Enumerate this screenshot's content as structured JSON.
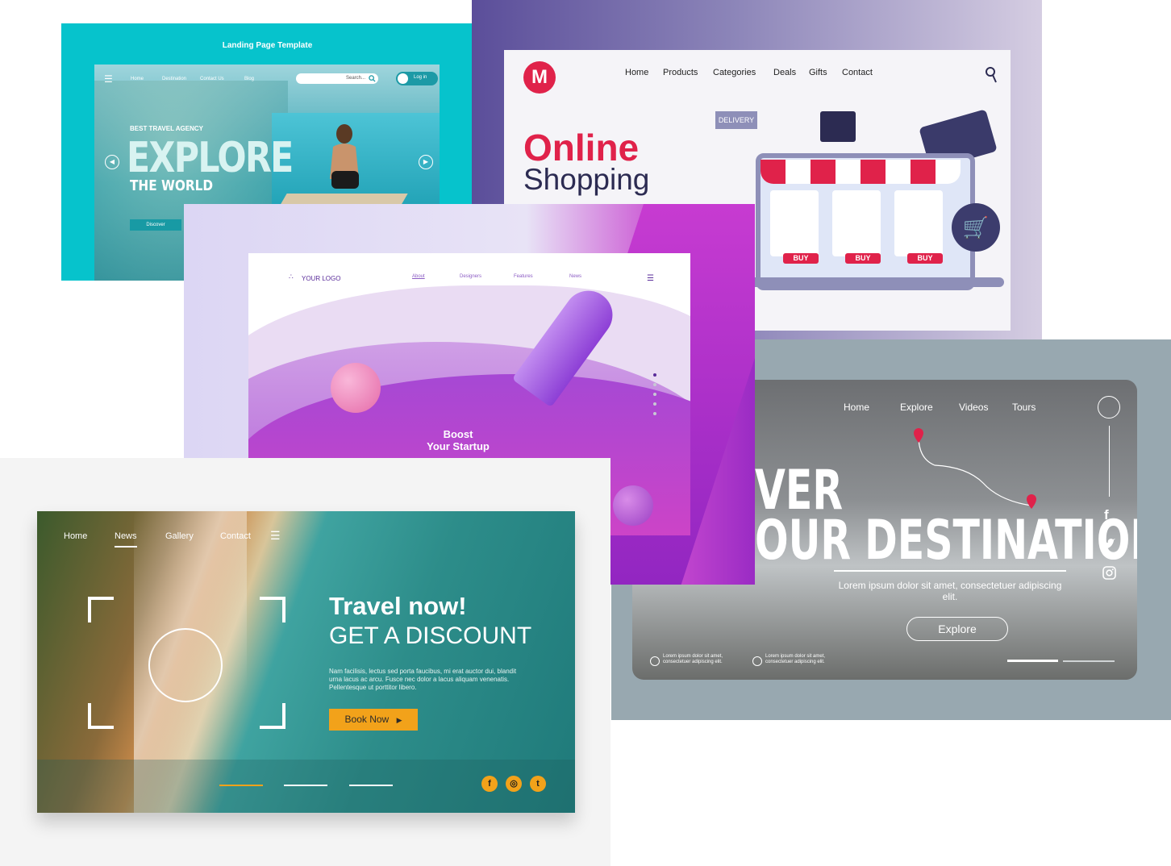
{
  "travel_agency": {
    "template_title": "Landing Page Template",
    "nav": [
      "Home",
      "Destination",
      "Contact Us",
      "Blog"
    ],
    "search_placeholder": "Search...",
    "login_label": "Log in",
    "tagline": "BEST TRAVEL AGENCY",
    "headline": "EXPLORE",
    "subheadline": "THE WORLD",
    "discover_label": "Discover"
  },
  "shopping": {
    "logo_letter": "M",
    "nav": [
      "Home",
      "Products",
      "Categories",
      "Deals",
      "Gifts",
      "Contact"
    ],
    "headline1": "Online",
    "headline2": "Shopping",
    "delivery_label": "DELIVERY",
    "buy_labels": [
      "BUY",
      "BUY",
      "BUY"
    ],
    "colors": {
      "accent": "#e0224a",
      "navy": "#2c2b52"
    }
  },
  "destination": {
    "nav": [
      "Home",
      "Explore",
      "Videos",
      "Tours"
    ],
    "headline1": "VER",
    "headline2": "OUR DESTINATION",
    "lorem": "Lorem ipsum dolor sit amet, consectetuer adipiscing elit.",
    "explore_label": "Explore",
    "social": [
      "f",
      "t",
      "ig"
    ],
    "footer_notes": [
      "Lorem ipsum dolor sit amet, consectetuer adipiscing elit.",
      "Lorem ipsum dolor sit amet, consectetuer adipiscing elit."
    ]
  },
  "startup": {
    "logo": "YOUR LOGO",
    "nav": [
      "About",
      "Designers",
      "Features",
      "News"
    ],
    "headline1": "Boost",
    "headline2": "Your Startup"
  },
  "travel_now": {
    "nav": [
      "Home",
      "News",
      "Gallery",
      "Contact"
    ],
    "headline1": "Travel now!",
    "headline2": "GET A DISCOUNT",
    "lorem": "Nam facilisis, lectus sed porta faucibus, mi erat auctor dui, blandit urna lacus ac arcu. Fusce nec dolor a lacus aliquam venenatis. Pellentesque ut porttitor libero.",
    "book_label": "Book Now",
    "social": [
      "f",
      "ig",
      "t"
    ],
    "colors": {
      "accent": "#f2a21a"
    }
  }
}
